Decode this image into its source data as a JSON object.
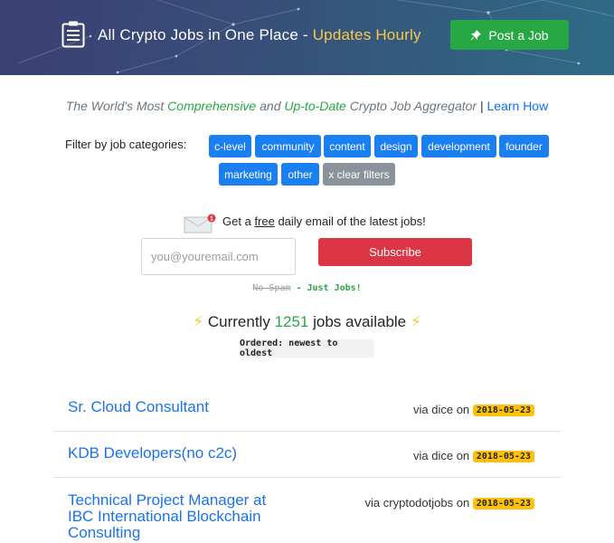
{
  "header": {
    "title_main": "All Crypto Jobs in One Place - ",
    "title_highlight": "Updates Hourly",
    "post_button": "Post a Job",
    "logo_icon": "clipboard-icon",
    "post_icon": "pushpin-icon"
  },
  "tagline": {
    "part1": "The World's Most ",
    "comprehensive": "Comprehensive",
    "part2": " and ",
    "uptodate": "Up-to-Date",
    "part3": " Crypto Job Aggregator",
    "separator": " | ",
    "learn": "Learn How"
  },
  "filters": {
    "label": "Filter by job categories:",
    "tags": [
      "c-level",
      "community",
      "content",
      "design",
      "development",
      "founder",
      "marketing",
      "other"
    ],
    "clear": "x clear filters"
  },
  "email": {
    "prefix": "Get a ",
    "free": "free",
    "suffix": " daily email of the latest jobs!",
    "placeholder": "you@youremail.com",
    "subscribe": "Subscribe",
    "no_spam": "No Spam",
    "just_jobs": " - Just Jobs!",
    "badge": "1"
  },
  "count": {
    "prefix": "Currently ",
    "number": "1251",
    "suffix": " jobs available ",
    "ordered": "Ordered: newest to oldest"
  },
  "jobs": [
    {
      "title": "Sr. Cloud Consultant",
      "via": "via dice on ",
      "date": "2018-05-23"
    },
    {
      "title": "KDB Developers(no c2c)",
      "via": "via dice on ",
      "date": "2018-05-23"
    },
    {
      "title": "Technical Project Manager at IBC International Blockchain Consulting",
      "via": "via cryptodotjobs on ",
      "date": "2018-05-23"
    }
  ],
  "colors": {
    "header_bg": "#3b3f73",
    "highlight": "#f7c948",
    "green": "#28a745",
    "blue": "#1a7ff0",
    "red": "#dc3545",
    "date_badge": "#ffc107"
  }
}
